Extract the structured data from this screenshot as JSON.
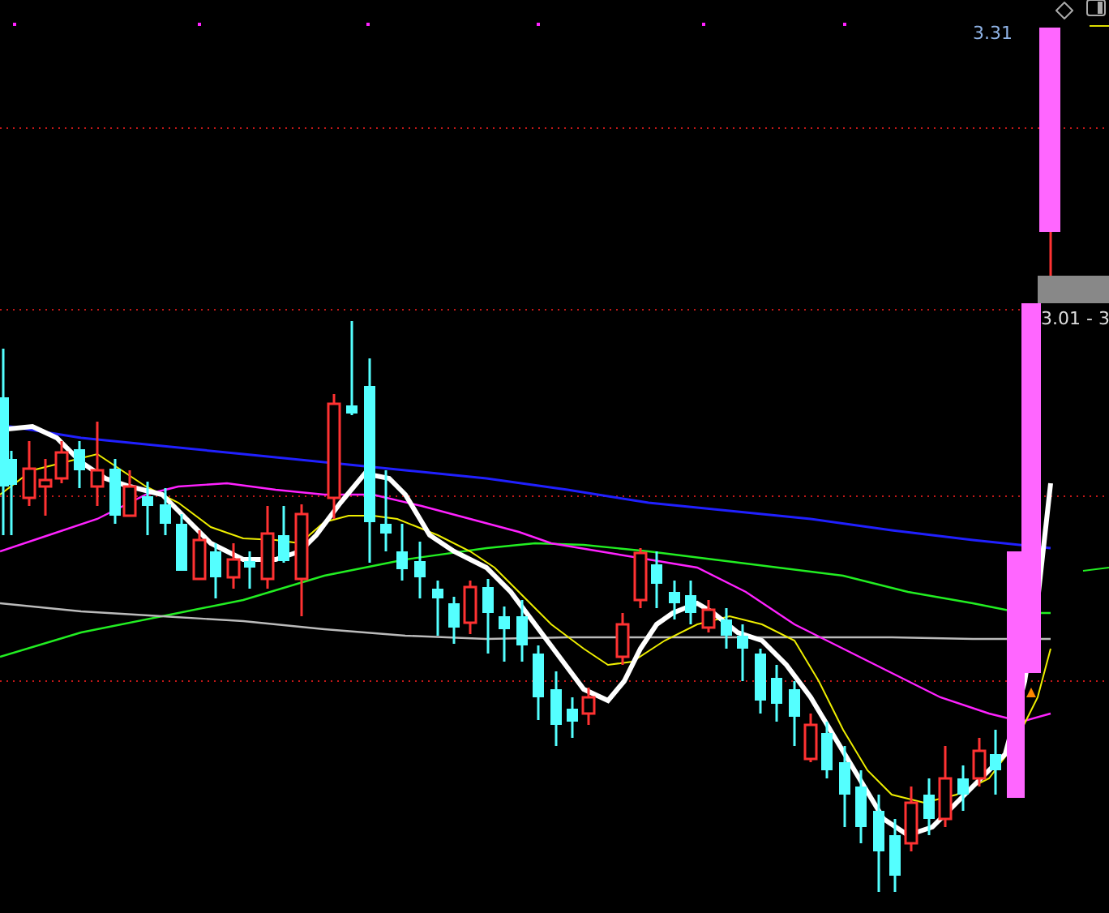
{
  "price_labels": [
    {
      "text": "3.31"
    },
    {
      "text": "3.01 - 3"
    }
  ]
}
